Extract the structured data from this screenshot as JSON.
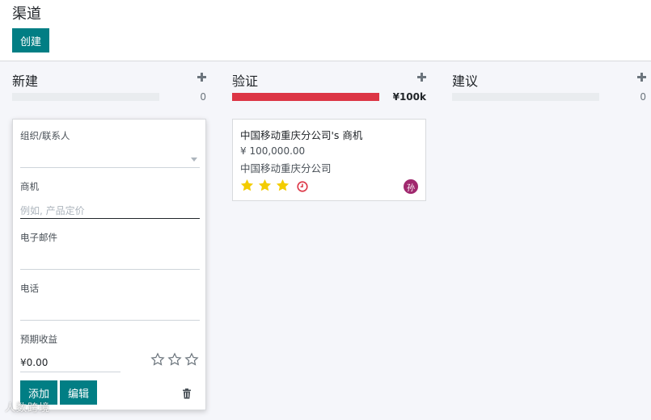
{
  "header": {
    "title": "渠道",
    "create_label": "创建"
  },
  "columns": [
    {
      "title": "新建",
      "total": "0",
      "progress": 0
    },
    {
      "title": "验证",
      "total": "¥100k",
      "progress": 1.0,
      "progress_color": "#dc3545"
    },
    {
      "title": "建议",
      "total": "0",
      "progress": 0
    }
  ],
  "quick_create": {
    "org_label": "组织/联系人",
    "opportunity_label": "商机",
    "opportunity_placeholder": "例如, 产品定价",
    "email_label": "电子邮件",
    "phone_label": "电话",
    "revenue_label": "预期收益",
    "revenue_value": "¥0.00",
    "priority_stars": 0,
    "add_label": "添加",
    "edit_label": "编辑"
  },
  "card": {
    "name": "中国移动重庆分公司's 商机",
    "amount": "¥ 100,000.00",
    "company": "中国移动重庆分公司",
    "priority_stars": 3,
    "avatar_letter": "孙",
    "avatar_color": "#a0286e"
  },
  "watermark": "人数跨境",
  "colors": {
    "accent": "#017e84",
    "star": "#f3cc00"
  }
}
